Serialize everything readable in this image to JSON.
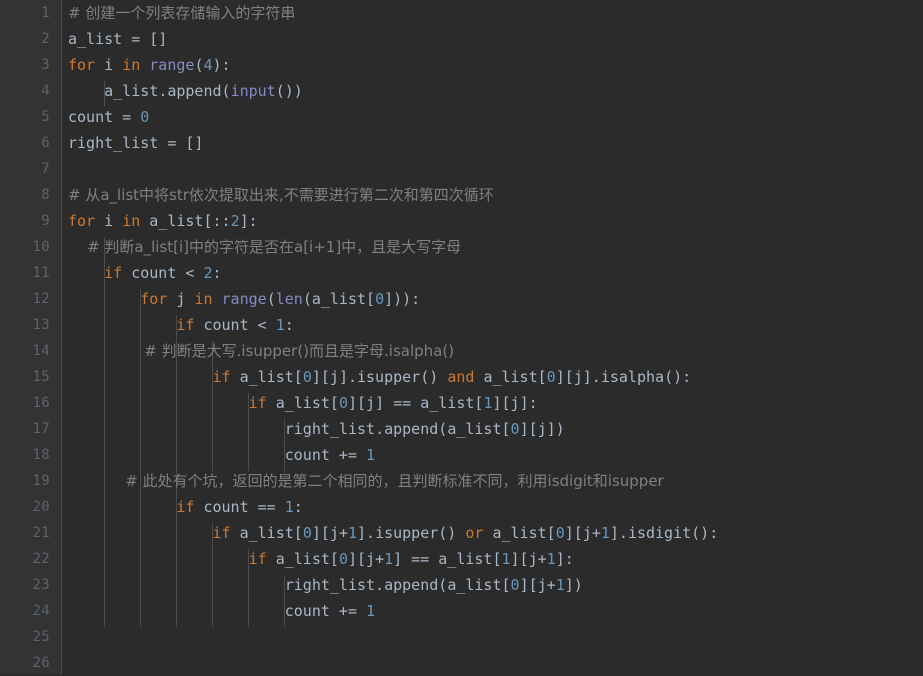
{
  "editor": {
    "theme_name": "darcula",
    "background": "#2b2b2b",
    "gutter_background": "#313335",
    "line_number_color": "#606366",
    "default_text_color": "#a9b7c6",
    "keyword_color": "#cc7832",
    "number_color": "#6897bb",
    "builtin_color": "#8888c6",
    "comment_color": "#808080",
    "language": "Python",
    "first_visible_line": 1,
    "last_visible_line": 26,
    "total_visible_lines": 26
  },
  "line_numbers": [
    "1",
    "2",
    "3",
    "4",
    "5",
    "6",
    "7",
    "8",
    "9",
    "10",
    "11",
    "12",
    "13",
    "14",
    "15",
    "16",
    "17",
    "18",
    "19",
    "20",
    "21",
    "22",
    "23",
    "24",
    "25",
    "26"
  ],
  "code_lines": [
    {
      "n": 1,
      "indent": 0,
      "text": "# 创建一个列表存储输入的字符串"
    },
    {
      "n": 2,
      "indent": 0,
      "text": "a_list = []"
    },
    {
      "n": 3,
      "indent": 0,
      "text": "for i in range(4):"
    },
    {
      "n": 4,
      "indent": 1,
      "text": "a_list.append(input())"
    },
    {
      "n": 5,
      "indent": 0,
      "text": "count = 0"
    },
    {
      "n": 6,
      "indent": 0,
      "text": "right_list = []"
    },
    {
      "n": 7,
      "indent": 0,
      "text": ""
    },
    {
      "n": 8,
      "indent": 0,
      "text": "# 从a_list中将str依次提取出来,不需要进行第二次和第四次循环"
    },
    {
      "n": 9,
      "indent": 0,
      "text": "for i in a_list[::2]:"
    },
    {
      "n": 10,
      "indent": 1,
      "text": "# 判断a_list[i]中的字符是否在a[i+1]中，且是大写字母"
    },
    {
      "n": 11,
      "indent": 1,
      "text": "if count < 2:"
    },
    {
      "n": 12,
      "indent": 2,
      "text": "for j in range(len(a_list[0])):"
    },
    {
      "n": 13,
      "indent": 3,
      "text": "if count < 1:"
    },
    {
      "n": 14,
      "indent": 4,
      "text": "# 判断是大写.isupper()而且是字母.isalpha()"
    },
    {
      "n": 15,
      "indent": 4,
      "text": "if a_list[0][j].isupper() and a_list[0][j].isalpha():"
    },
    {
      "n": 16,
      "indent": 5,
      "text": "if a_list[0][j] == a_list[1][j]:"
    },
    {
      "n": 17,
      "indent": 6,
      "text": "right_list.append(a_list[0][j])"
    },
    {
      "n": 18,
      "indent": 6,
      "text": "count += 1"
    },
    {
      "n": 19,
      "indent": 3,
      "text": "# 此处有个坑，返回的是第二个相同的，且判断标准不同，利用isdigit和isupper"
    },
    {
      "n": 20,
      "indent": 3,
      "text": "if count == 1:"
    },
    {
      "n": 21,
      "indent": 4,
      "text": "if a_list[0][j+1].isupper() or a_list[0][j+1].isdigit():"
    },
    {
      "n": 22,
      "indent": 5,
      "text": "if a_list[0][j+1] == a_list[1][j+1]:"
    },
    {
      "n": 23,
      "indent": 6,
      "text": "right_list.append(a_list[0][j+1])"
    },
    {
      "n": 24,
      "indent": 6,
      "text": "count += 1"
    },
    {
      "n": 25,
      "indent": 0,
      "text": ""
    },
    {
      "n": 26,
      "indent": 0,
      "text": ""
    }
  ],
  "fold_markers": [
    {
      "line": 9,
      "type": "open",
      "label": "collapse-fold-region"
    },
    {
      "line": 11,
      "type": "open",
      "label": "collapse-fold-region"
    },
    {
      "line": 12,
      "type": "open",
      "label": "collapse-fold-region"
    },
    {
      "line": 13,
      "type": "open",
      "label": "collapse-fold-region"
    },
    {
      "line": 15,
      "type": "open",
      "label": "collapse-fold-region"
    },
    {
      "line": 16,
      "type": "open",
      "label": "collapse-fold-region"
    },
    {
      "line": 18,
      "type": "end",
      "label": "fold-region-end"
    },
    {
      "line": 20,
      "type": "open",
      "label": "collapse-fold-region"
    },
    {
      "line": 21,
      "type": "open",
      "label": "collapse-fold-region"
    },
    {
      "line": 22,
      "type": "open",
      "label": "collapse-fold-region"
    },
    {
      "line": 24,
      "type": "end",
      "label": "fold-region-end"
    }
  ],
  "tokens": {
    "keywords": [
      "for",
      "in",
      "if",
      "and",
      "or"
    ],
    "builtins": [
      "range",
      "input",
      "len"
    ],
    "numbers": [
      "0",
      "1",
      "2",
      "4"
    ]
  }
}
